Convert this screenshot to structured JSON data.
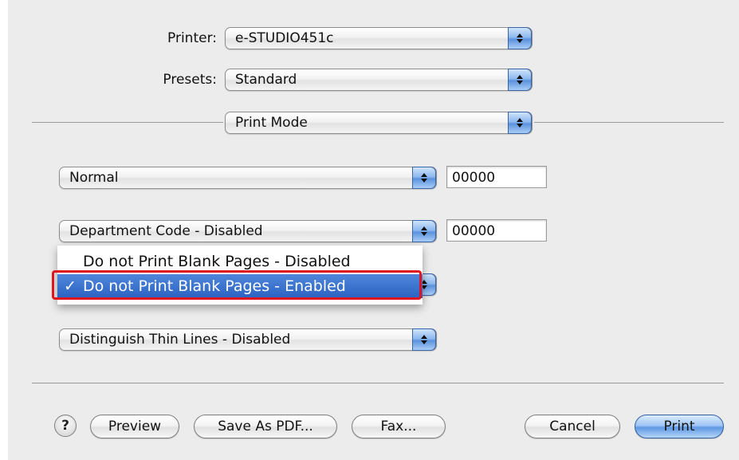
{
  "printer": {
    "label": "Printer:",
    "value": "e-STUDIO451c"
  },
  "presets": {
    "label": "Presets:",
    "value": "Standard"
  },
  "section_popup": {
    "value": "Print Mode"
  },
  "options": {
    "mode": {
      "value": "Normal",
      "field": "00000"
    },
    "department": {
      "value": "Department Code - Disabled",
      "field": "00000"
    },
    "thin_lines": {
      "value": "Distinguish Thin Lines - Disabled"
    }
  },
  "blank_pages_menu": {
    "items": [
      {
        "label": "Do not Print Blank Pages - Disabled",
        "selected": false
      },
      {
        "label": "Do not Print Blank Pages - Enabled",
        "selected": true
      }
    ],
    "check_mark": "✓"
  },
  "buttons": {
    "help": "?",
    "preview": "Preview",
    "save_as_pdf": "Save As PDF...",
    "fax": "Fax...",
    "cancel": "Cancel",
    "print": "Print"
  },
  "colors": {
    "highlight_border": "#e0141e",
    "selection": "#2c63c2",
    "popup_arrow": "#5b92de"
  }
}
